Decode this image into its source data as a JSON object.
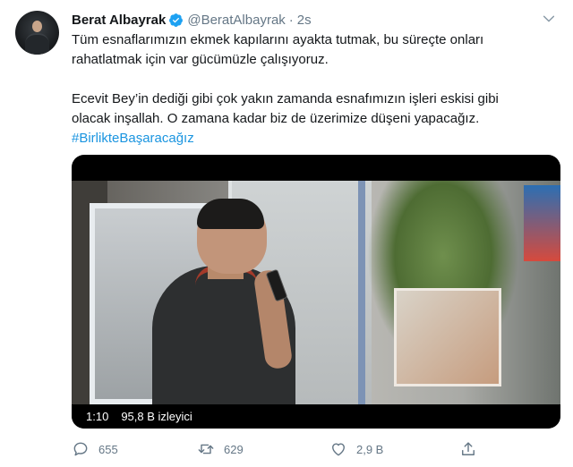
{
  "user": {
    "name": "Berat Albayrak",
    "handle": "@BeratAlbayrak",
    "separator": "·",
    "time": "2s"
  },
  "tweet": {
    "paragraph1_line1": "Tüm esnaflarımızın ekmek kapılarını ayakta tutmak, bu süreçte onları",
    "paragraph1_line2": "rahatlatmak için var gücümüzle çalışıyoruz.",
    "paragraph2_line1": "Ecevit Bey’in dediği gibi çok yakın zamanda esnafımızın işleri eskisi gibi",
    "paragraph2_line2": "olacak inşallah. O zamana kadar biz de üzerimize düşeni yapacağız.",
    "hashtag": "#BirlikteBaşaracağız"
  },
  "video": {
    "duration": "1:10",
    "views": "95,8 B izleyici"
  },
  "actions": {
    "replies": "655",
    "retweets": "629",
    "likes": "2,9 B"
  },
  "icons": {
    "verified": "verified-badge-icon",
    "more": "chevron-down-icon",
    "reply": "reply-icon",
    "retweet": "retweet-icon",
    "like": "heart-icon",
    "share": "share-icon"
  },
  "colors": {
    "accent": "#1b95e0",
    "secondary_text": "#657786",
    "primary_text": "#14171a"
  }
}
